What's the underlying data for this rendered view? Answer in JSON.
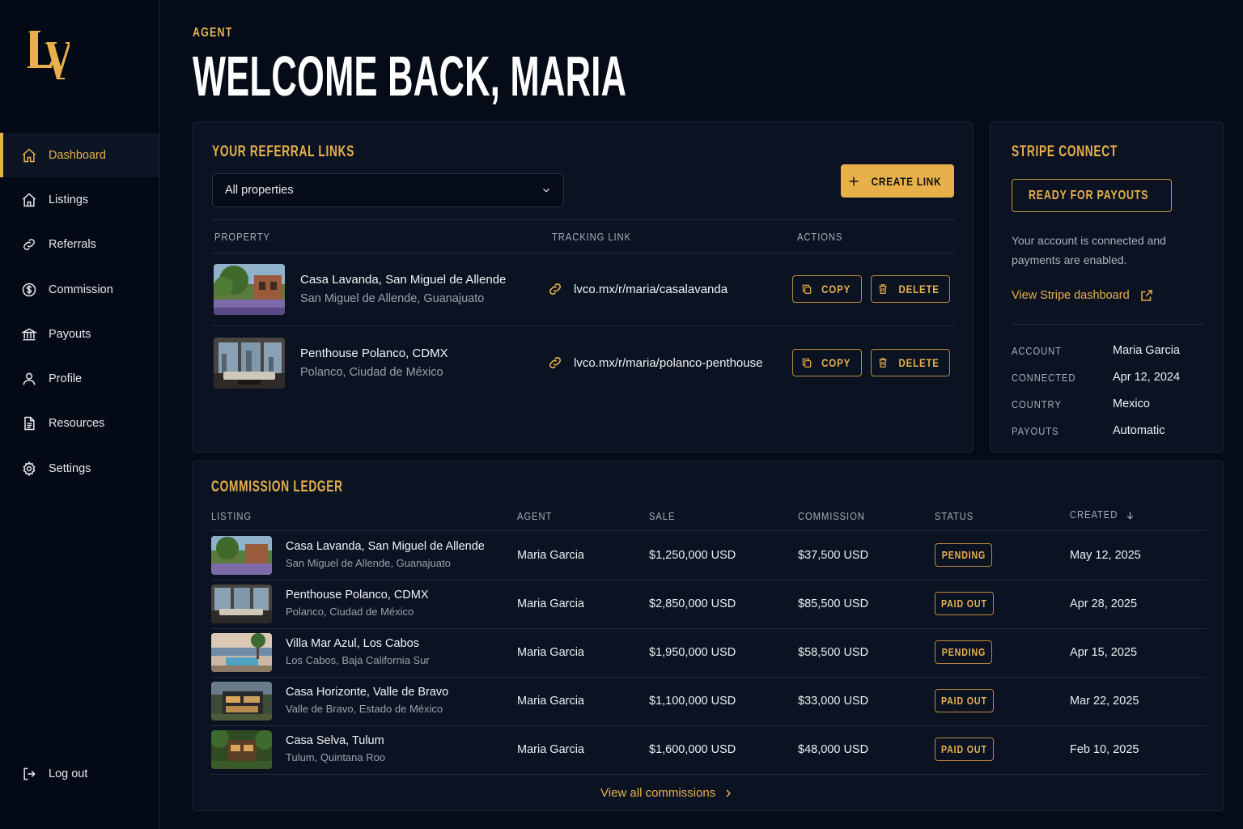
{
  "sidebar": {
    "logo_text": "LV",
    "items": [
      {
        "label": "Dashboard",
        "icon": "home-icon"
      },
      {
        "label": "Listings",
        "icon": "house-icon"
      },
      {
        "label": "Referrals",
        "icon": "link-icon"
      },
      {
        "label": "Commission",
        "icon": "dollar-circle-icon"
      },
      {
        "label": "Payouts",
        "icon": "bank-icon"
      },
      {
        "label": "Profile",
        "icon": "user-icon"
      },
      {
        "label": "Resources",
        "icon": "document-icon"
      },
      {
        "label": "Settings",
        "icon": "gear-icon"
      }
    ],
    "logout_label": "Log out"
  },
  "header": {
    "eyebrow": "AGENT",
    "title": "WELCOME BACK, MARIA"
  },
  "referrals": {
    "title": "YOUR REFERRAL LINKS",
    "filter_value": "All properties",
    "create_label": "CREATE LINK",
    "columns": [
      "PROPERTY",
      "TRACKING LINK",
      "ACTIONS"
    ],
    "rows": [
      {
        "name": "Casa Lavanda, San Miguel de Allende",
        "location": "San Miguel de Allende, Guanajuato",
        "link": "lvco.mx/r/maria/casalavanda"
      },
      {
        "name": "Penthouse Polanco, CDMX",
        "location": "Polanco, Ciudad de México",
        "link": "lvco.mx/r/maria/polanco-penthouse"
      }
    ],
    "copy_label": "COPY",
    "delete_label": "DELETE"
  },
  "stripe": {
    "title": "STRIPE CONNECT",
    "status": "READY FOR PAYOUTS",
    "description": "Your account is connected and payments are enabled.",
    "dashboard_link": "View Stripe dashboard",
    "details": [
      {
        "key": "ACCOUNT",
        "value": "Maria Garcia"
      },
      {
        "key": "CONNECTED",
        "value": "Apr 12, 2024"
      },
      {
        "key": "COUNTRY",
        "value": "Mexico"
      },
      {
        "key": "PAYOUTS",
        "value": "Automatic"
      }
    ]
  },
  "ledger": {
    "title": "COMMISSION LEDGER",
    "columns": [
      "LISTING",
      "AGENT",
      "SALE",
      "COMMISSION",
      "STATUS",
      "CREATED"
    ],
    "rows": [
      {
        "name": "Casa Lavanda, San Miguel de Allende",
        "location": "San Miguel de Allende, Guanajuato",
        "agent": "Maria Garcia",
        "sale": "$1,250,000 USD",
        "commission": "$37,500 USD",
        "status": "PENDING",
        "created": "May 12, 2025"
      },
      {
        "name": "Penthouse Polanco, CDMX",
        "location": "Polanco, Ciudad de México",
        "agent": "Maria Garcia",
        "sale": "$2,850,000 USD",
        "commission": "$85,500 USD",
        "status": "PAID OUT",
        "created": "Apr 28, 2025"
      },
      {
        "name": "Villa Mar Azul, Los Cabos",
        "location": "Los Cabos, Baja California Sur",
        "agent": "Maria Garcia",
        "sale": "$1,950,000 USD",
        "commission": "$58,500 USD",
        "status": "PENDING",
        "created": "Apr 15, 2025"
      },
      {
        "name": "Casa Horizonte, Valle de Bravo",
        "location": "Valle de Bravo, Estado de México",
        "agent": "Maria Garcia",
        "sale": "$1,100,000 USD",
        "commission": "$33,000 USD",
        "status": "PAID OUT",
        "created": "Mar 22, 2025"
      },
      {
        "name": "Casa Selva, Tulum",
        "location": "Tulum, Quintana Roo",
        "agent": "Maria Garcia",
        "sale": "$1,600,000 USD",
        "commission": "$48,000 USD",
        "status": "PAID OUT",
        "created": "Feb 10, 2025"
      }
    ],
    "view_all": "View all commissions"
  },
  "colors": {
    "accent": "#e7b04b",
    "background": "#050c18",
    "card": "#0b1322"
  }
}
